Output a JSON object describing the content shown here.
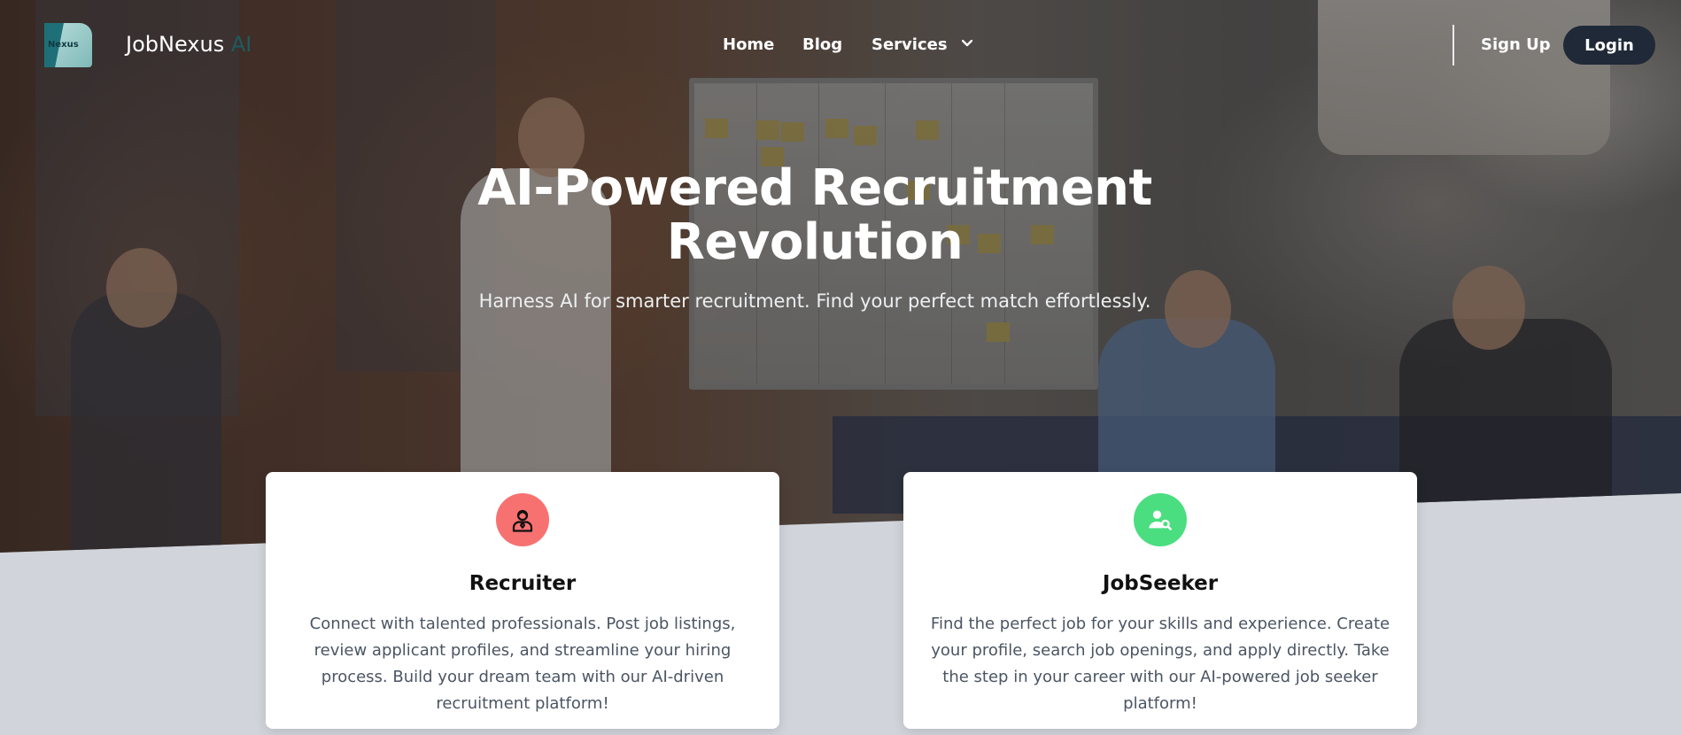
{
  "brand": {
    "name": "JobNexus",
    "suffix": "AI",
    "logo_text": "Nexus"
  },
  "nav": {
    "home": "Home",
    "blog": "Blog",
    "services": "Services",
    "signup": "Sign Up",
    "login": "Login"
  },
  "hero": {
    "title_line1": "AI-Powered Recruitment",
    "title_line2": "Revolution",
    "subtitle": "Harness AI for smarter recruitment. Find your perfect match effortlessly."
  },
  "cards": [
    {
      "title": "Recruiter",
      "icon": "recruiter-icon",
      "color": "#f87171",
      "description": "Connect with talented professionals. Post job listings, review applicant profiles, and streamline your hiring process. Build your dream team with our AI-driven recruitment platform!"
    },
    {
      "title": "JobSeeker",
      "icon": "user-search-icon",
      "color": "#4ade80",
      "description": "Find the perfect job for your skills and experience. Create your profile, search job openings, and apply directly. Take the step in your career with our AI-powered job seeker platform!"
    }
  ],
  "colors": {
    "login_bg": "#1f2937",
    "brand_ai": "#1e5b5f",
    "page_bg": "#d1d5db"
  }
}
